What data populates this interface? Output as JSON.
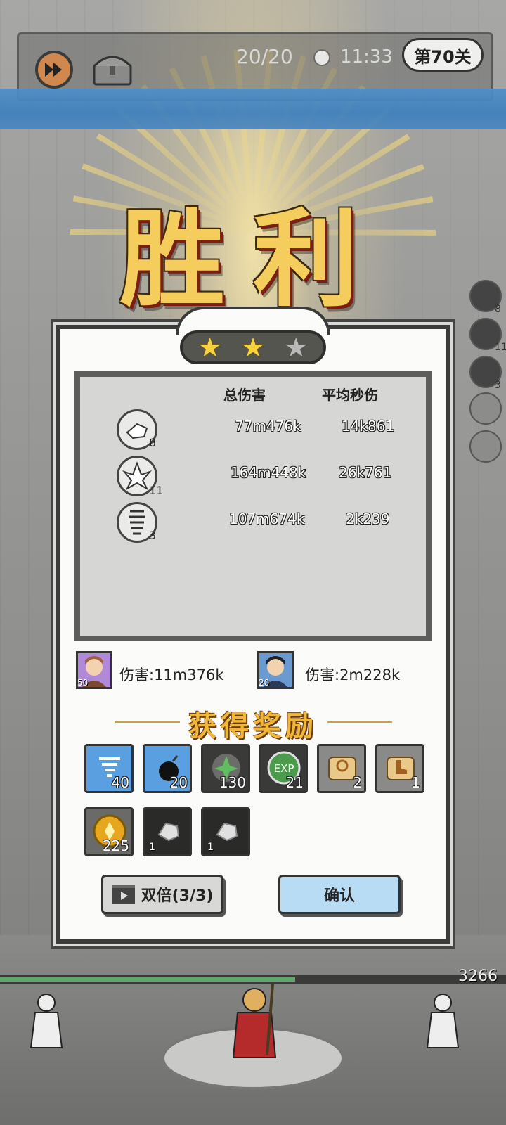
{
  "topbar": {
    "progress": "20/20",
    "time": "11:33",
    "level": "第70关"
  },
  "victory_title": "胜利",
  "stars": {
    "earned": 2,
    "total": 3
  },
  "stats": {
    "col_total": "总伤害",
    "col_dps": "平均秒伤",
    "rows": [
      {
        "icon": "stone-block-skill-icon",
        "level": "8",
        "total": "77m476k",
        "dps": "14k861"
      },
      {
        "icon": "crystal-burst-skill-icon",
        "level": "11",
        "total": "164m448k",
        "dps": "26k761"
      },
      {
        "icon": "whirlwind-skill-icon",
        "level": "3",
        "total": "107m674k",
        "dps": "2k239"
      }
    ]
  },
  "heroes": [
    {
      "level": "50",
      "damage": "伤害:11m376k"
    },
    {
      "level": "20",
      "damage": "伤害:2m228k"
    }
  ],
  "rewards_title": "获得奖励",
  "rewards": [
    {
      "name": "tornado-gem-icon",
      "count": "40",
      "color": "#5aa0e0"
    },
    {
      "name": "bomb-gem-icon",
      "count": "20",
      "color": "#5aa0e0"
    },
    {
      "name": "leaf-crystal-icon",
      "count": "130",
      "color": "#4c8a4c"
    },
    {
      "name": "exp-orb-icon",
      "count": "21",
      "color": "#4c8a4c"
    },
    {
      "name": "ring-scroll-icon",
      "count": "2",
      "color": "#e8c98a"
    },
    {
      "name": "boot-scroll-icon",
      "count": "1",
      "color": "#e8c98a"
    },
    {
      "name": "gold-coin-icon",
      "count": "225",
      "color": "#e6a61e"
    },
    {
      "name": "iron-ore-icon",
      "count": "1",
      "color": "#2a2a28"
    },
    {
      "name": "iron-ore-icon",
      "count": "1",
      "color": "#2a2a28"
    }
  ],
  "exp_label": "EXP",
  "buttons": {
    "double": "双倍(3/3)",
    "confirm": "确认"
  },
  "side_counts": [
    "8",
    "11",
    "3"
  ],
  "castle_hp": "3266"
}
